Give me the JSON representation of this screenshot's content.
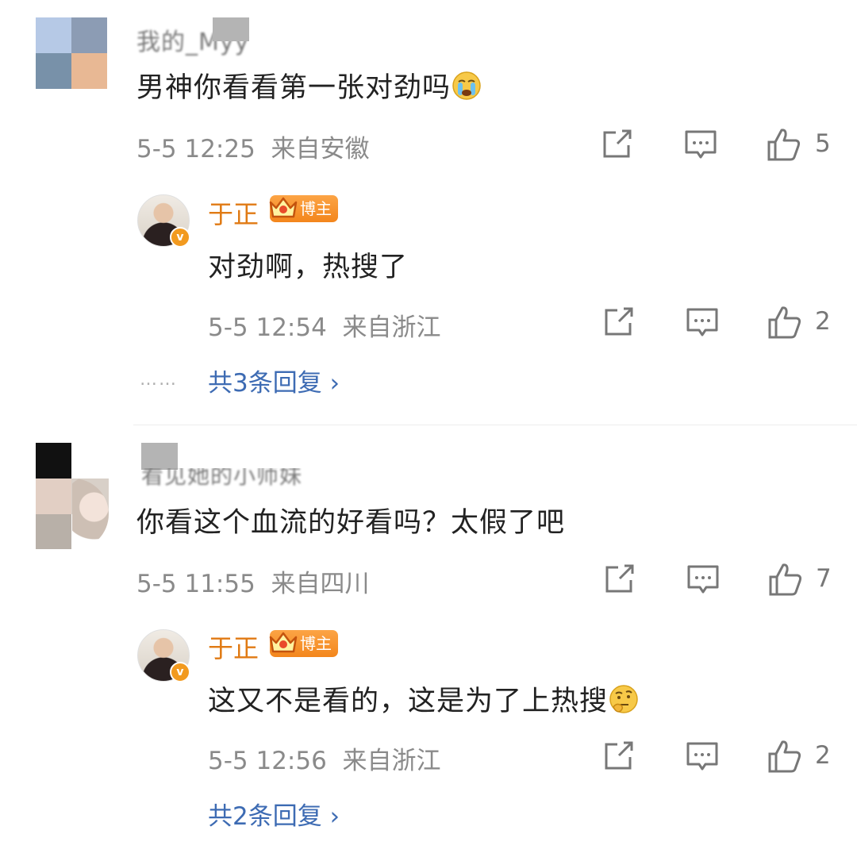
{
  "comments": [
    {
      "username": "我的_Myy",
      "text": "男神你看看第一张对劲吗",
      "emoji": "crying-emoji",
      "time": "5-5 12:25",
      "location": "来自安徽",
      "likes": "5",
      "avatar_colors": [
        "#b6c9e6",
        "#8c9cb4",
        "#7891a9",
        "#e8b894"
      ],
      "reply": {
        "name": "于正",
        "badge": "博主",
        "text": "对劲啊，热搜了",
        "time": "5-5 12:54",
        "location": "来自浙江",
        "likes": "2"
      },
      "more_dots": "……",
      "more_replies": "共3条回复 ›"
    },
    {
      "username": "看见她的小师妹",
      "text": "你看这个血流的好看吗？太假了吧",
      "time": "5-5 11:55",
      "location": "来自四川",
      "likes": "7",
      "avatar_colors": [
        "#111111",
        "#ffffff",
        "#e2cfc4",
        "#d8d0c8",
        "#b8b0a8",
        "#ffffff"
      ],
      "reply": {
        "name": "于正",
        "badge": "博主",
        "text": "这又不是看的，这是为了上热搜",
        "emoji": "thinking-emoji",
        "time": "5-5 12:56",
        "location": "来自浙江",
        "likes": "2"
      },
      "more_replies": "共2条回复 ›"
    }
  ],
  "colors": {
    "reply_name": "#e07a14",
    "link": "#3d6bb3",
    "meta": "#8a8a8a"
  },
  "icons": [
    "share-icon",
    "comment-icon",
    "like-icon",
    "crown-icon",
    "verified-icon"
  ]
}
